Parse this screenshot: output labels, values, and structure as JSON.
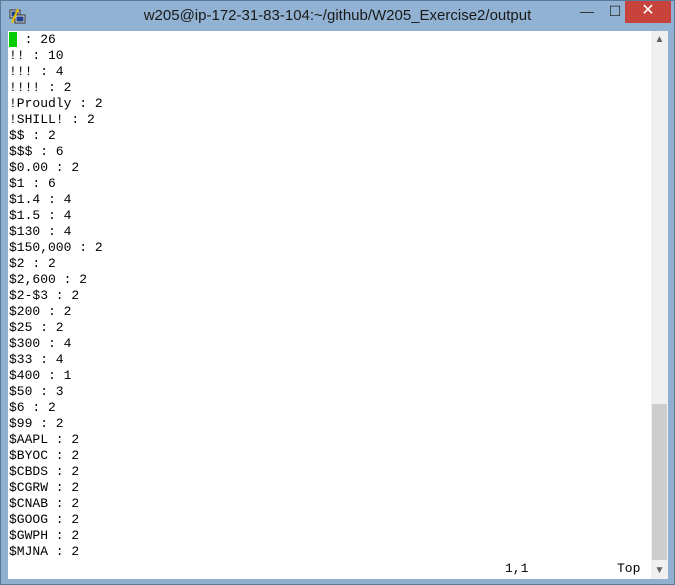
{
  "window": {
    "title": "w205@ip-172-31-83-104:~/github/W205_Exercise2/output",
    "minimize_glyph": "—",
    "maximize_glyph": "☐",
    "close_glyph": "✕"
  },
  "terminal": {
    "first_line": {
      "cursor_char": "!",
      "rest": " : 26"
    },
    "lines": [
      "!! : 10",
      "!!! : 4",
      "!!!! : 2",
      "!Proudly : 2",
      "!SHILL! : 2",
      "$$ : 2",
      "$$$ : 6",
      "$0.00 : 2",
      "$1 : 6",
      "$1.4 : 4",
      "$1.5 : 4",
      "$130 : 4",
      "$150,000 : 2",
      "$2 : 2",
      "$2,600 : 2",
      "$2-$3 : 2",
      "$200 : 2",
      "$25 : 2",
      "$300 : 4",
      "$33 : 4",
      "$400 : 1",
      "$50 : 3",
      "$6 : 2",
      "$99 : 2",
      "$AAPL : 2",
      "$BYOC : 2",
      "$CBDS : 2",
      "$CGRW : 2",
      "$CNAB : 2",
      "$GOOG : 2",
      "$GWPH : 2",
      "$MJNA : 2"
    ],
    "status_position": "1,1",
    "status_scroll": "Top"
  },
  "scrollbar": {
    "up_glyph": "▲",
    "down_glyph": "▼"
  },
  "colors": {
    "cursor": "#00cc00",
    "titlebar": "#91b2d2",
    "close_button": "#c7433b"
  },
  "icons": {
    "app": "putty-icon"
  }
}
